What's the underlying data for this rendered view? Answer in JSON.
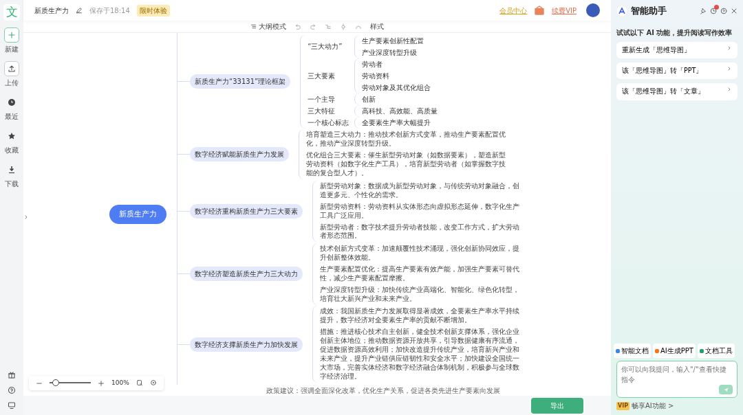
{
  "sidebar": {
    "logo": "文",
    "items": [
      {
        "label": "新建",
        "kind": "new"
      },
      {
        "label": "上传",
        "kind": "upload"
      },
      {
        "label": "最近",
        "kind": "recent"
      },
      {
        "label": "收藏",
        "kind": "star"
      },
      {
        "label": "下载",
        "kind": "download"
      }
    ]
  },
  "header": {
    "title": "新质生产力",
    "saved": "保存于18:14",
    "badge": "限时体验",
    "member_center": "会员中心",
    "vip": "续费VIP"
  },
  "toolbar": {
    "outline_mode": "大纲模式",
    "style": "样式"
  },
  "mindmap": {
    "root": "新质生产力",
    "branches": [
      {
        "label": "新质生产力“33131”理论框架",
        "kind": "tree",
        "children": [
          {
            "label": "“三大动力”",
            "children": [
              {
                "label": "生产要素创新性配置"
              },
              {
                "label": "产业深度转型升级"
              }
            ]
          },
          {
            "label": "三大要素",
            "children": [
              {
                "label": "劳动者"
              },
              {
                "label": "劳动资料"
              },
              {
                "label": "劳动对象及其优化组合"
              }
            ]
          },
          {
            "label": "一个主导",
            "children": [
              {
                "label": "创新"
              }
            ]
          },
          {
            "label": "三大特征",
            "children": [
              {
                "label": "高科技、高效能、高质量"
              }
            ]
          },
          {
            "label": "一个核心标志",
            "children": [
              {
                "label": "全要素生产率大幅提升"
              }
            ]
          }
        ]
      },
      {
        "label": "数字经济赋能新质生产力发展",
        "kind": "notes",
        "notes": [
          "培育塑造三大动力：推动技术创新方式变革，推动生产要素配置优化，推动产业深度转型升级。",
          "优化组合三大要素：催生新型劳动对象（如数据要素），塑造新型劳动资料（如数字化生产工具），培育新型劳动者（如掌握数字技能的复合型人才）。"
        ]
      },
      {
        "label": "数字经济重构新质生产力三大要素",
        "kind": "notes",
        "notes": [
          "新型劳动对象：数据成为新型劳动对象，与传统劳动对象融合，创造更多元、个性化的需求。",
          "新型劳动资料：劳动资料从实体形态向虚拟形态延伸，数字化生产工具广泛应用。",
          "新型劳动者：数字技术提升劳动者技能，改变工作方式，扩大劳动者形态范围。"
        ]
      },
      {
        "label": "数字经济塑造新质生产力三大动力",
        "kind": "notes",
        "notes": [
          "技术创新方式变革：加速颠覆性技术涌现，强化创新协同效应，提升创新整体效能。",
          "生产要素配置优化：提高生产要素有效产能，加强生产要素可替代性，减少生产要素配置摩擦。",
          "产业深度转型升级：加快传统产业高端化、智能化、绿色化转型，培育壮大新兴产业和未来产业。"
        ]
      },
      {
        "label": "数字经济支撑新质生产力加快发展",
        "kind": "notes",
        "notes": [
          "成效：我国新质生产力发展取得显著成效，全要素生产率水平持续提升，数字经济对全要素生产率的贡献不断增加。",
          "措施：推进核心技术自主创新，健全技术创新支撑体系，强化企业创新主体地位；推动数据资源开放共享，引导数据健康有序流通，促进数据资源高效利用；加快改造提升传统产业，培育新兴产业和未来产业，提升产业链供应链韧性和安全水平；加快建设全国统一大市场，完善实体经济和数字经济融合体制机制，积极参与全球数字经济治理。"
        ]
      }
    ],
    "footer_note": "政策建议：强调全面深化改革，优化生产关系，促进各类先进生产要素向发展"
  },
  "zoom": {
    "level": 0.15,
    "reading": "100%"
  },
  "export": "导出",
  "assistant": {
    "title": "智能助手",
    "prompt": "试试以下 AI 功能，提升阅读写作效率",
    "suggestions": [
      "重新生成「思维导图」",
      "该「思维导图」转「PPT」",
      "该「思维导图」转「文章」"
    ],
    "tools": [
      {
        "label": "智能文档",
        "color": "#3b82f6"
      },
      {
        "label": "AI生成PPT",
        "color": "#f97316"
      },
      {
        "label": "文档工具",
        "color": "#22a06b"
      }
    ],
    "placeholder": "你可以向我提问，输入\"/\"查看快捷指令",
    "vip_badge": "VIP",
    "vip_link": "畅享AI功能 >"
  }
}
